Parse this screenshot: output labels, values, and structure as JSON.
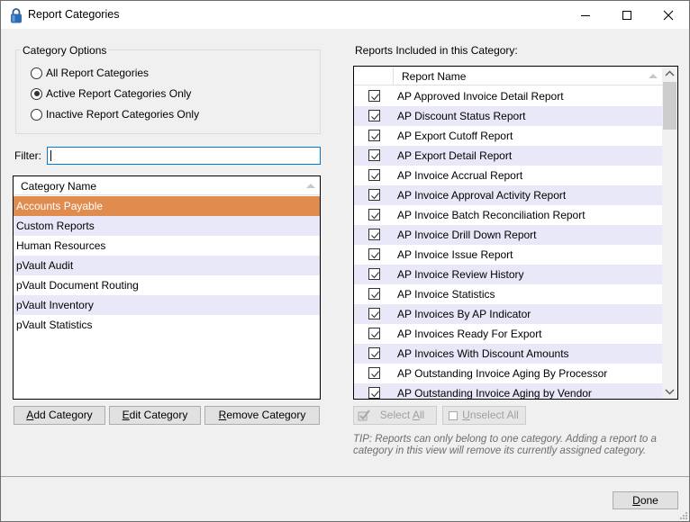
{
  "window": {
    "title": "Report Categories",
    "icon": "padlock-icon",
    "controls": [
      "minimize",
      "maximize",
      "close"
    ]
  },
  "category_options": {
    "label": "Category Options",
    "options": [
      {
        "label": "All Report Categories",
        "checked": false
      },
      {
        "label": "Active Report Categories Only",
        "checked": true
      },
      {
        "label": "Inactive Report Categories Only",
        "checked": false
      }
    ]
  },
  "filter": {
    "label": "Filter:",
    "value": ""
  },
  "categories_grid": {
    "header": "Category Name",
    "rows": [
      {
        "name": "Accounts Payable",
        "selected": true
      },
      {
        "name": "Custom Reports"
      },
      {
        "name": "Human Resources"
      },
      {
        "name": "pVault Audit"
      },
      {
        "name": "pVault Document Routing"
      },
      {
        "name": "pVault Inventory"
      },
      {
        "name": "pVault Statistics"
      }
    ]
  },
  "category_buttons": {
    "add": {
      "accel": "A",
      "rest": "dd Category"
    },
    "edit": {
      "accel": "E",
      "rest": "dit Category"
    },
    "remove": {
      "accel": "R",
      "rest": "emove Category"
    }
  },
  "reports": {
    "label": "Reports Included in this Category:",
    "header": "Report Name",
    "rows": [
      {
        "name": "AP Approved Invoice Detail Report",
        "checked": true
      },
      {
        "name": "AP Discount Status Report",
        "checked": true
      },
      {
        "name": "AP Export Cutoff Report",
        "checked": true
      },
      {
        "name": "AP Export Detail Report",
        "checked": true
      },
      {
        "name": "AP Invoice Accrual Report",
        "checked": true
      },
      {
        "name": "AP Invoice Approval Activity Report",
        "checked": true
      },
      {
        "name": "AP Invoice Batch Reconciliation Report",
        "checked": true
      },
      {
        "name": "AP Invoice Drill Down Report",
        "checked": true
      },
      {
        "name": "AP Invoice Issue Report",
        "checked": true
      },
      {
        "name": "AP Invoice Review History",
        "checked": true
      },
      {
        "name": "AP Invoice Statistics",
        "checked": true
      },
      {
        "name": "AP Invoices By AP Indicator",
        "checked": true
      },
      {
        "name": "AP Invoices Ready For Export",
        "checked": true
      },
      {
        "name": "AP Invoices With Discount Amounts",
        "checked": true
      },
      {
        "name": "AP Outstanding Invoice Aging By Processor",
        "checked": true
      },
      {
        "name": "AP Outstanding Invoice Aging by Vendor",
        "checked": true
      }
    ]
  },
  "report_buttons": {
    "select_all": {
      "pre": "Select ",
      "accel": "A",
      "rest": "ll",
      "enabled": false
    },
    "unselect_all": {
      "pre": "",
      "accel": "U",
      "rest": "nselect All",
      "enabled": false
    }
  },
  "tip": "TIP:  Reports can only belong to one category.  Adding a report to a category in this view will remove its currently assigned category.",
  "done_button": {
    "accel": "D",
    "rest": "one"
  },
  "colors": {
    "selected_row": "#e08c4f",
    "alt_row": "#e8e8f8",
    "focus_border": "#0078d7"
  }
}
